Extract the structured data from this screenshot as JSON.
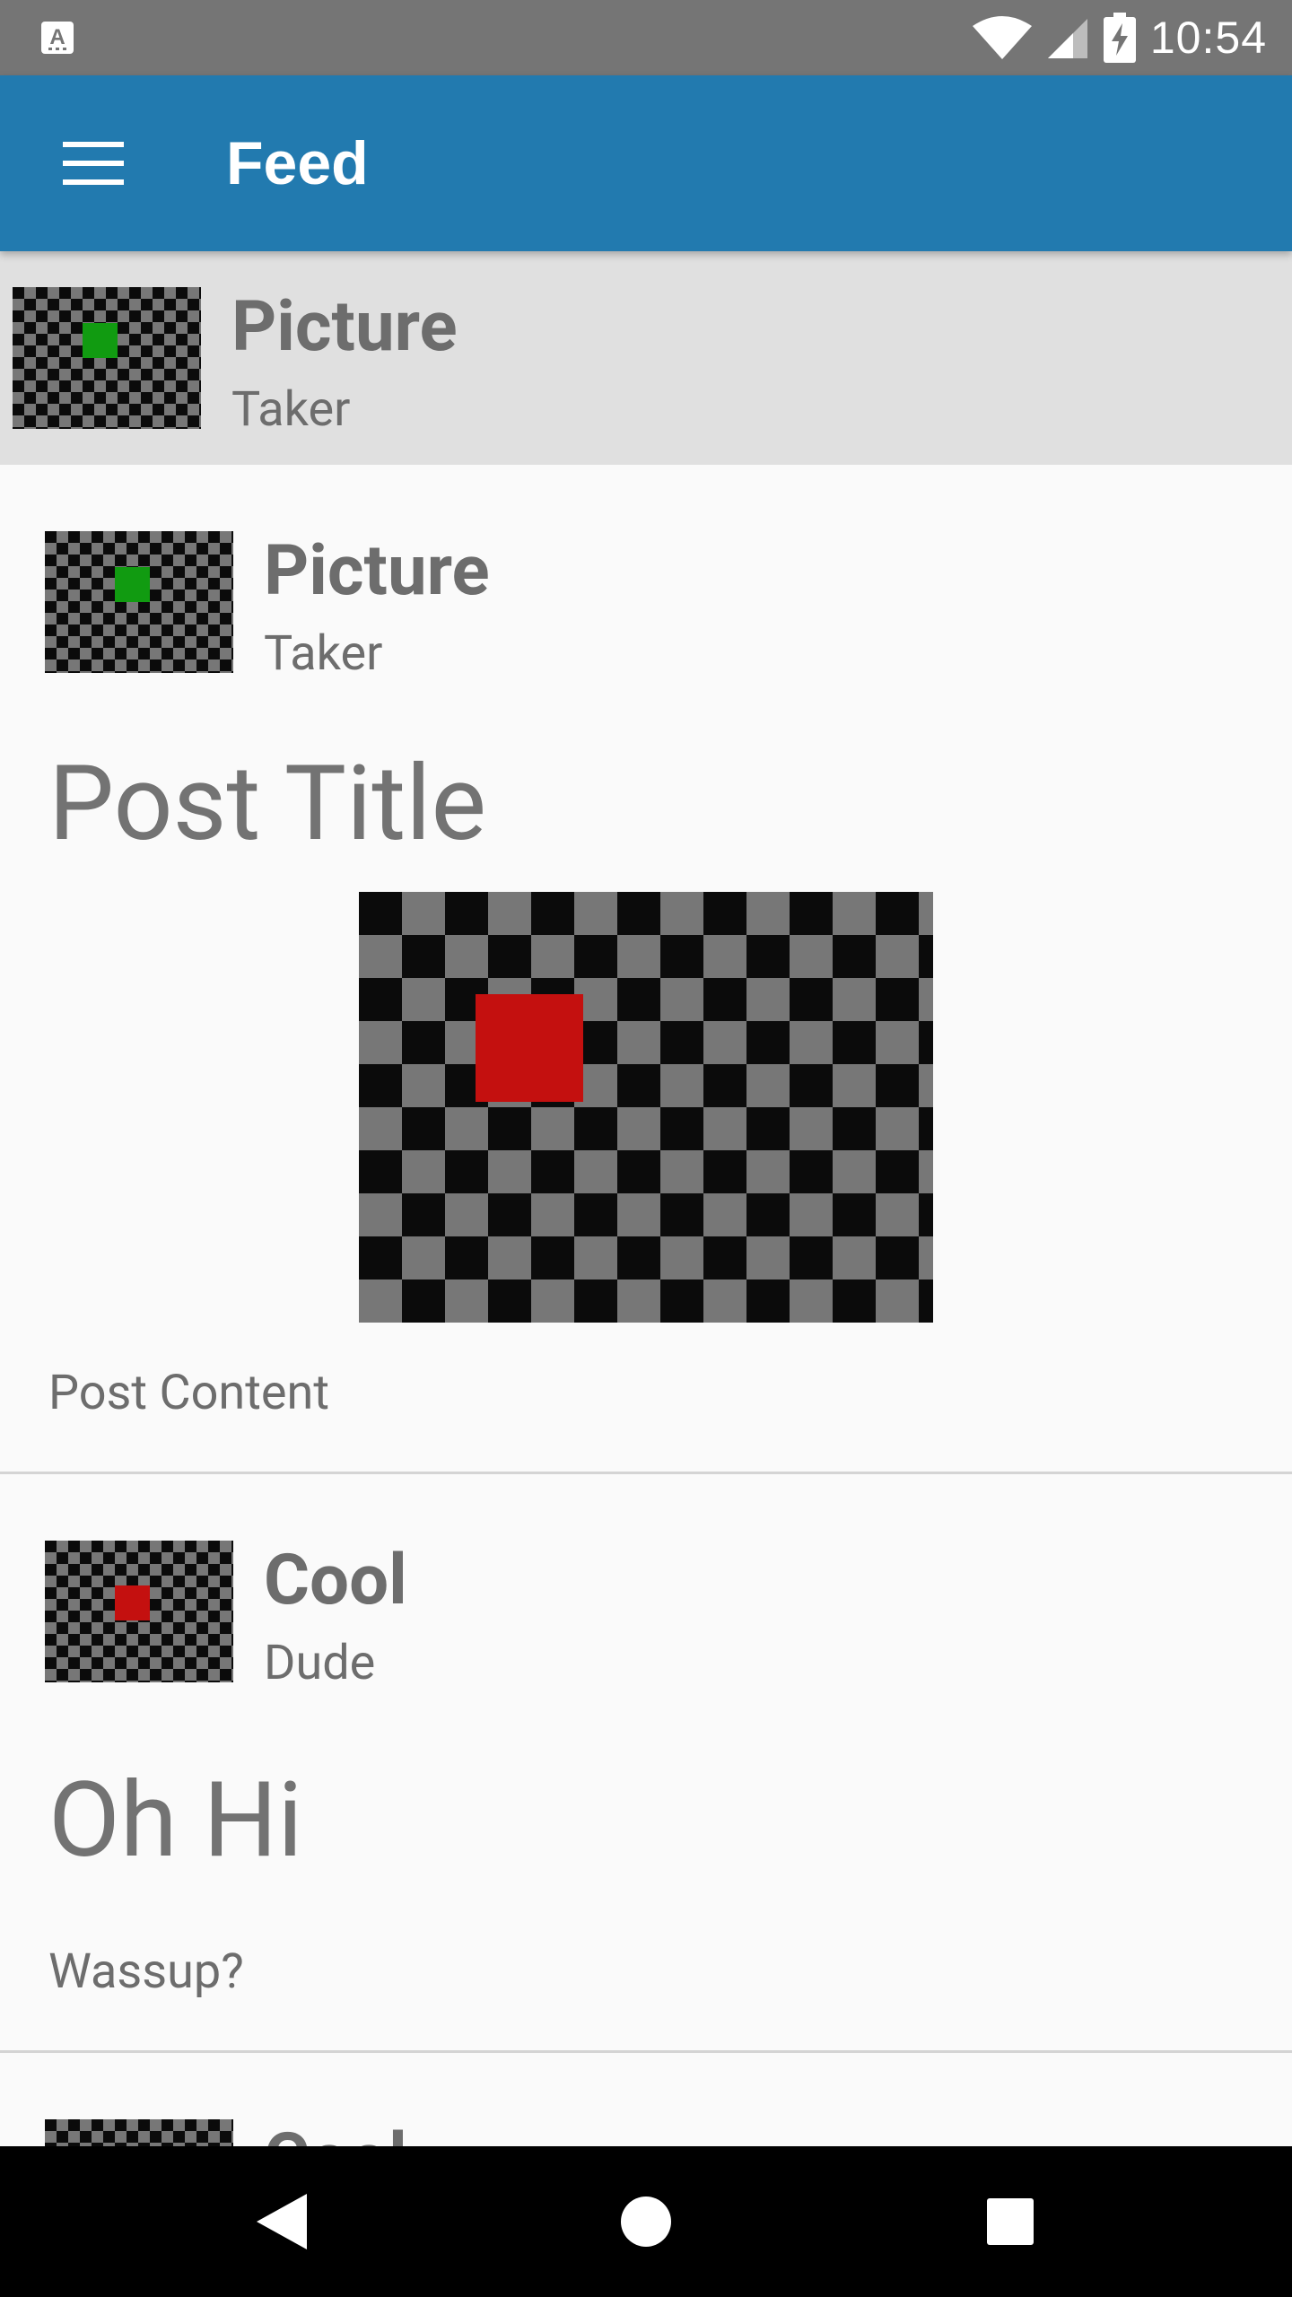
{
  "status_bar": {
    "time": "10:54",
    "icons": [
      "keyboard-notification-icon",
      "wifi-icon",
      "signal-icon",
      "battery-charging-icon"
    ]
  },
  "app_bar": {
    "title": "Feed",
    "menu_icon": "hamburger-menu-icon"
  },
  "header_user": {
    "name": "Picture",
    "subtitle": "Taker",
    "avatar_dot_color": "#119b11"
  },
  "posts": [
    {
      "author_name": "Picture",
      "author_sub": "Taker",
      "avatar_dot_color": "#119b11",
      "title": "Post Title",
      "has_image": true,
      "image_dot_color": "#c4100f",
      "content": "Post Content"
    },
    {
      "author_name": "Cool",
      "author_sub": "Dude",
      "avatar_dot_color": "#c4100f",
      "title": "Oh Hi",
      "has_image": false,
      "content": "Wassup?"
    },
    {
      "author_name": "Cool"
    }
  ],
  "nav_bar": {
    "buttons": [
      "back-icon",
      "home-icon",
      "recents-icon"
    ]
  },
  "colors": {
    "status_bar": "#757575",
    "app_bar": "#227aaf",
    "header_bg": "#e0e0e0",
    "feed_bg": "#fafafa",
    "text_gray": "#6d6d6d",
    "checker_light": "#777777",
    "checker_dark": "#0b0b0b",
    "green": "#119b11",
    "red": "#c4100f"
  }
}
